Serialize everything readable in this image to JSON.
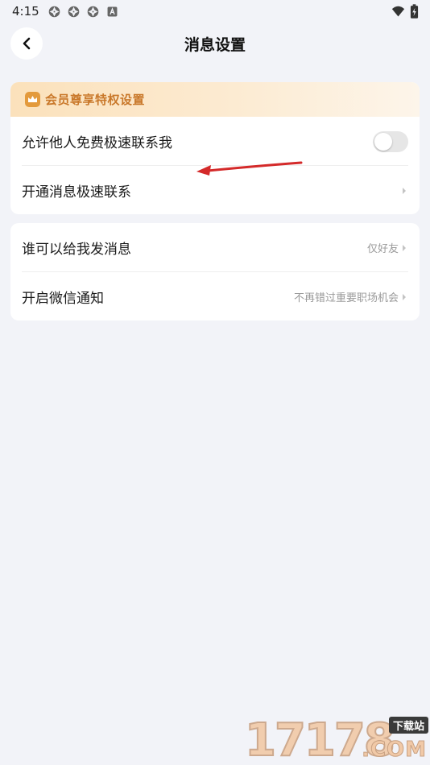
{
  "status_bar": {
    "time": "4:15",
    "notification_icons": [
      "aperture-icon",
      "aperture-icon",
      "aperture-icon",
      "font-a-icon"
    ],
    "right_icons": [
      "wifi-icon",
      "battery-charging-icon"
    ]
  },
  "header": {
    "title": "消息设置",
    "back_icon": "chevron-left-icon"
  },
  "vip_section": {
    "title": "会员尊享特权设置",
    "icon": "crown-icon",
    "accent_color": "#c9782a"
  },
  "settings_group_1": [
    {
      "label": "允许他人免费极速联系我",
      "control": "toggle",
      "toggle_on": false
    },
    {
      "label": "开通消息极速联系",
      "control": "chevron"
    }
  ],
  "settings_group_2": [
    {
      "label": "谁可以给我发消息",
      "value": "仅好友"
    },
    {
      "label": "开启微信通知",
      "value": "不再错过重要职场机会"
    }
  ],
  "annotation": {
    "arrow_color": "#d42a2a"
  },
  "watermark": {
    "digits": "17178",
    "badge": "下载站",
    "suffix": ".COM"
  }
}
